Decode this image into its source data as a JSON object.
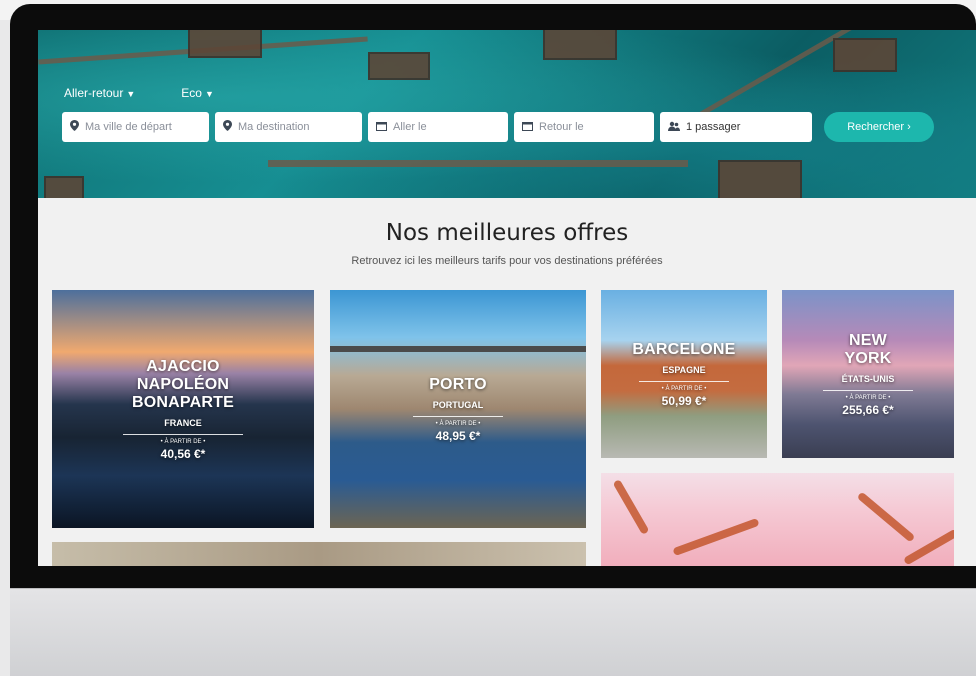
{
  "search": {
    "trip_type": "Aller-retour",
    "cabin_class": "Eco",
    "from_placeholder": "Ma ville de départ",
    "to_placeholder": "Ma destination",
    "depart_placeholder": "Aller le",
    "return_placeholder": "Retour le",
    "passengers": "1 passager",
    "submit_label": "Rechercher ›"
  },
  "offers": {
    "title": "Nos meilleures offres",
    "subtitle": "Retrouvez ici les meilleurs tarifs pour vos destinations préférées",
    "cards": [
      {
        "city": "AJACCIO NAPOLÉON BONAPARTE",
        "country": "FRANCE",
        "from_label": "• À PARTIR DE •",
        "price": "40,56 €*"
      },
      {
        "city": "PORTO",
        "country": "PORTUGAL",
        "from_label": "• À PARTIR DE •",
        "price": "48,95 €*"
      },
      {
        "city": "BARCELONE",
        "country": "ESPAGNE",
        "from_label": "• À PARTIR DE •",
        "price": "50,99 €*"
      },
      {
        "city": "NEW YORK",
        "country": "ÉTATS-UNIS",
        "from_label": "• À PARTIR DE •",
        "price": "255,66 €*"
      }
    ]
  },
  "icons": {
    "from": "map-pin-icon",
    "to": "map-pin-icon",
    "depart": "calendar-icon",
    "return": "calendar-icon",
    "passengers": "users-icon",
    "dropdown": "chevron-down-icon"
  },
  "colors": {
    "accent": "#1db7ad",
    "page_bg": "#f1f1f1",
    "title_text": "#222222"
  }
}
